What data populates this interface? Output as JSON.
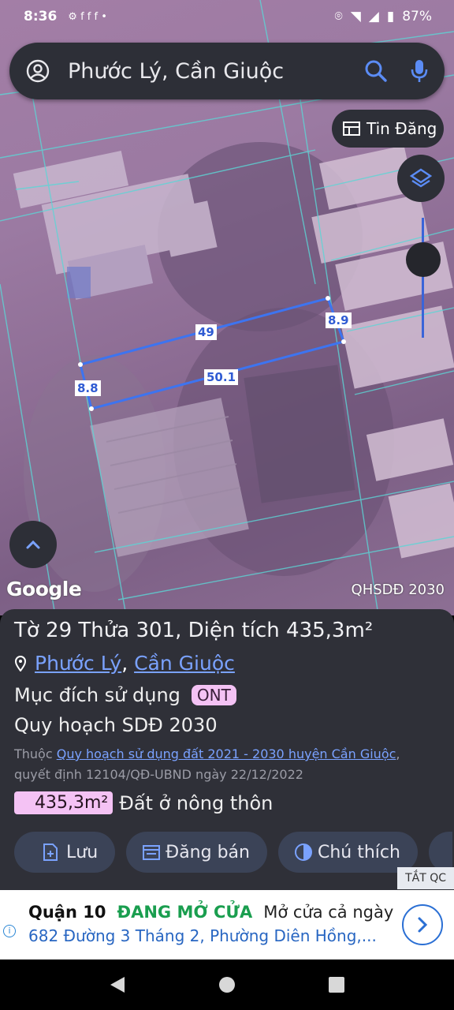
{
  "status_bar": {
    "time": "8:36",
    "battery": "87%"
  },
  "search": {
    "query": "Phước Lý, Cần Giuộc"
  },
  "map": {
    "tin_dang_label": "Tin Đăng",
    "google_label": "Google",
    "overlay_label": "QHSDĐ 2030",
    "dimensions": {
      "top": "49",
      "bottom": "50.1",
      "left": "8.8",
      "right": "8.9"
    }
  },
  "panel": {
    "title": "Tờ 29 Thửa 301, Diện tích 435,3m²",
    "ward": "Phước Lý",
    "district": "Cần Giuộc",
    "purpose_label": "Mục đích sử dụng",
    "purpose_code": "ONT",
    "plan_label": "Quy hoạch SDĐ 2030",
    "note_prefix": "Thuộc",
    "note_link": "Quy hoạch sử dụng đất 2021 - 2030 huyện Cần Giuộc",
    "note_suffix": ", quyết định 12104/QĐ-UBND ngày 22/12/2022",
    "area_value": "435,3m²",
    "area_type": "Đất ở nông thôn",
    "actions": {
      "save": "Lưu",
      "post": "Đăng bán",
      "legend": "Chú thích"
    }
  },
  "ad": {
    "close_label": "TẮT QC",
    "location": "Quận 10",
    "status": "ĐANG MỞ CỬA",
    "hours": "Mở cửa cả ngày",
    "address": "682 Đường 3 Tháng 2, Phường Diên Hồng,..."
  },
  "colors": {
    "panel_bg": "#2f3038",
    "accent": "#3a64d8",
    "badge": "#f4c2f4",
    "link": "#7aa2ff"
  }
}
